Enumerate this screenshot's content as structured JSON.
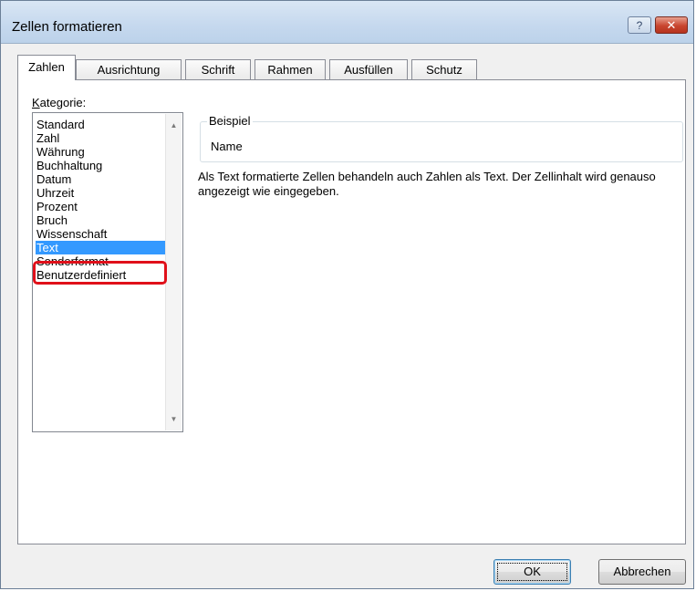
{
  "window": {
    "title": "Zellen formatieren",
    "help_label": "?",
    "close_label": "✕"
  },
  "tabs": [
    {
      "label": "Zahlen",
      "active": true
    },
    {
      "label": "Ausrichtung",
      "active": false
    },
    {
      "label": "Schrift",
      "active": false
    },
    {
      "label": "Rahmen",
      "active": false
    },
    {
      "label": "Ausfüllen",
      "active": false
    },
    {
      "label": "Schutz",
      "active": false
    }
  ],
  "category": {
    "label_accel": "K",
    "label_rest": "ategorie:",
    "items": [
      "Standard",
      "Zahl",
      "Währung",
      "Buchhaltung",
      "Datum",
      "Uhrzeit",
      "Prozent",
      "Bruch",
      "Wissenschaft",
      "Text",
      "Sonderformat",
      "Benutzerdefiniert"
    ],
    "selected": "Text"
  },
  "sample": {
    "legend": "Beispiel",
    "value": "Name"
  },
  "description": "Als Text formatierte Zellen behandeln auch Zahlen als Text. Der Zellinhalt wird genauso angezeigt wie eingegeben.",
  "buttons": {
    "ok": "OK",
    "cancel": "Abbrechen"
  },
  "colors": {
    "selection": "#3399ff",
    "annotation_border": "#e0101a",
    "close_button": "#c8452f"
  }
}
